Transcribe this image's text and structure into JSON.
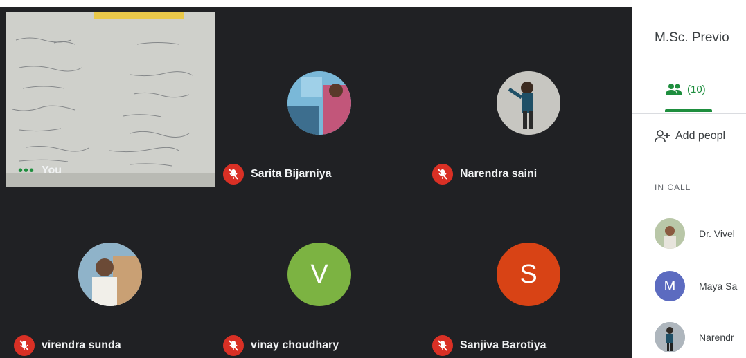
{
  "meeting": {
    "panel_title": "M.Sc. Previo",
    "people_count": "(10)",
    "add_people_label": "Add peopl",
    "in_call_label": "IN CALL"
  },
  "tiles": [
    {
      "name": "You",
      "type": "self"
    },
    {
      "name": "Sarita Bijarniya",
      "muted": true,
      "avatar": "photo"
    },
    {
      "name": "Narendra saini",
      "muted": true,
      "avatar": "photo"
    },
    {
      "name": "virendra sunda",
      "muted": true,
      "avatar": "photo"
    },
    {
      "name": "vinay choudhary",
      "muted": true,
      "avatar_letter": "V",
      "avatar_color": "#7cb342"
    },
    {
      "name": "Sanjiva Barotiya",
      "muted": true,
      "avatar_letter": "S",
      "avatar_color": "#d84315"
    }
  ],
  "participants": [
    {
      "name": "Dr. Vivel",
      "avatar": "photo"
    },
    {
      "name": "Maya Sa",
      "avatar_letter": "M",
      "avatar_color": "#5c6bc0"
    },
    {
      "name": "Narendr",
      "avatar": "photo"
    }
  ],
  "icons": {
    "mic_off": "mic-off-icon",
    "people": "people-icon",
    "add_person": "add-person-icon",
    "more": "more-dots-icon"
  }
}
